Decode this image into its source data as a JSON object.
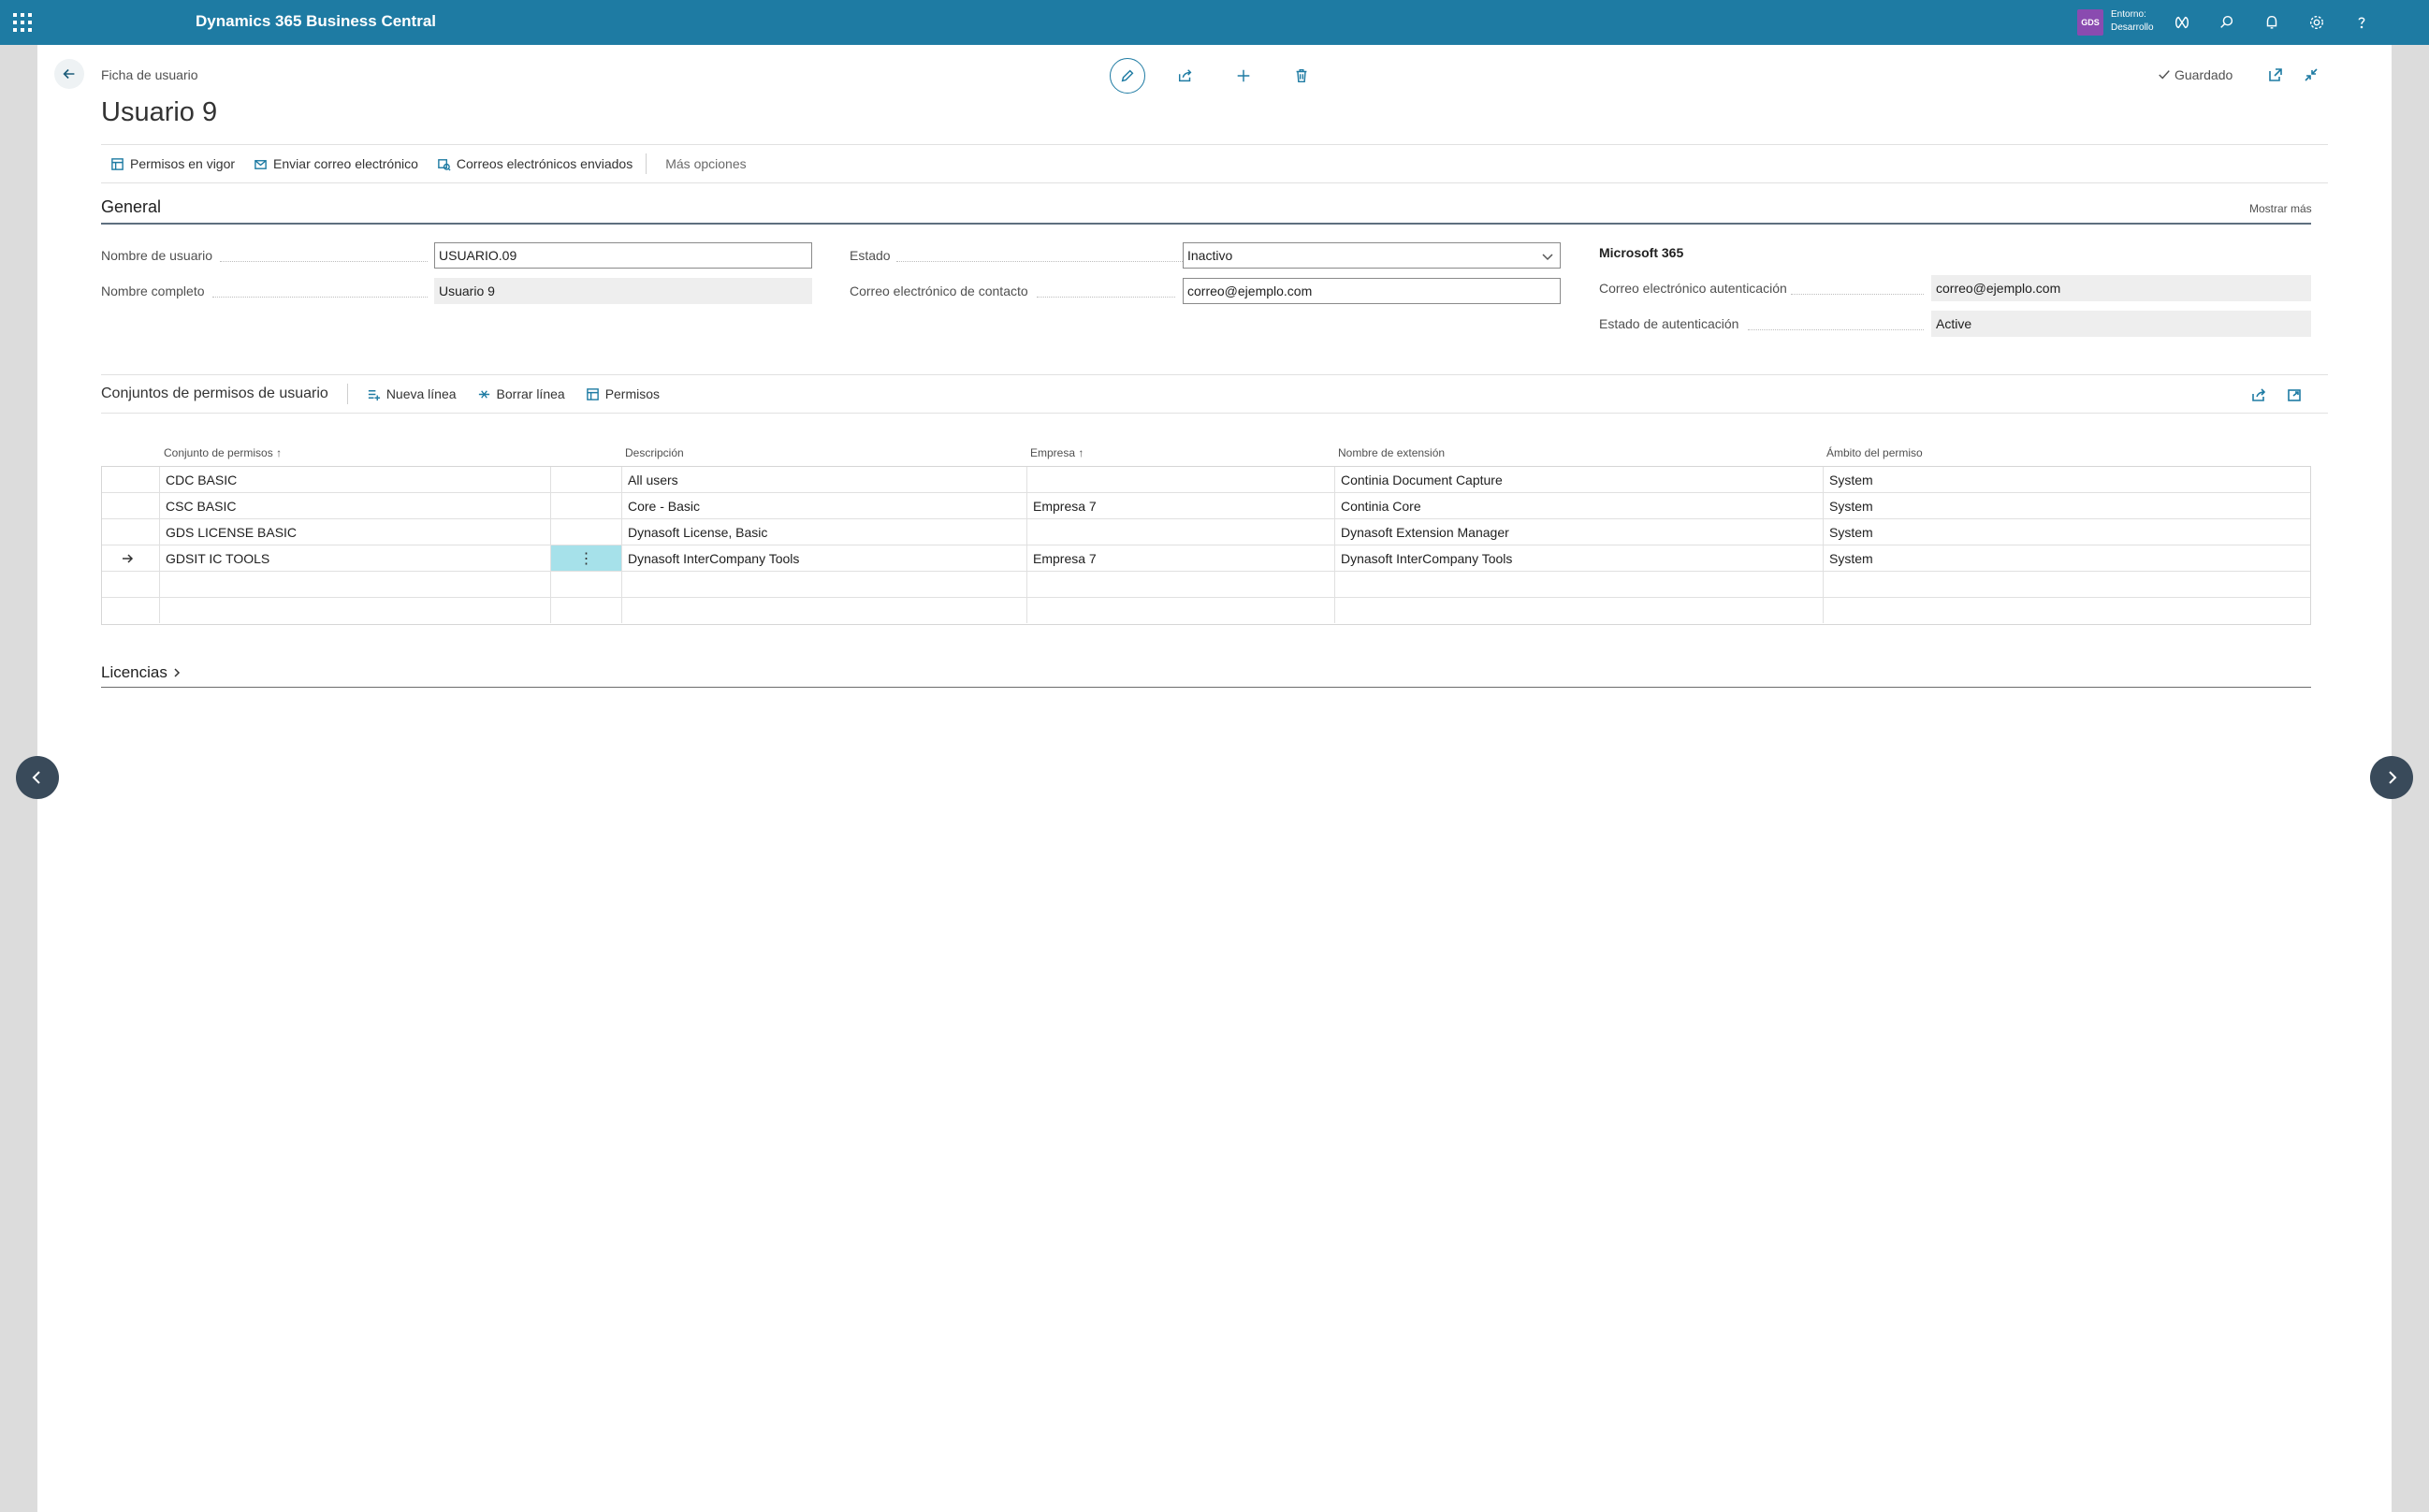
{
  "app": {
    "title": "Dynamics 365 Business Central",
    "env_badge": "GDS",
    "env_label": "Entorno:",
    "env_value": "Desarrollo"
  },
  "page": {
    "breadcrumb": "Ficha de usuario",
    "title": "Usuario 9",
    "saved_label": "Guardado"
  },
  "actions": {
    "effective_permissions": "Permisos en vigor",
    "send_email": "Enviar correo electrónico",
    "sent_emails": "Correos electrónicos enviados",
    "more_options": "Más opciones"
  },
  "general": {
    "title": "General",
    "show_more": "Mostrar más",
    "user_name_label": "Nombre de usuario",
    "user_name_value": "USUARIO.09",
    "full_name_label": "Nombre completo",
    "full_name_value": "Usuario 9",
    "state_label": "Estado",
    "state_value": "Inactivo",
    "contact_email_label": "Correo electrónico de contacto",
    "contact_email_value": "correo@ejemplo.com",
    "m365_title": "Microsoft 365",
    "auth_email_label": "Correo electrónico autenticación",
    "auth_email_value": "correo@ejemplo.com",
    "auth_state_label": "Estado de autenticación",
    "auth_state_value": "Active"
  },
  "permissions": {
    "title": "Conjuntos de permisos de usuario",
    "new_line": "Nueva línea",
    "delete_line": "Borrar línea",
    "permissions": "Permisos",
    "columns": {
      "set": "Conjunto de permisos",
      "description": "Descripción",
      "company": "Empresa",
      "extension": "Nombre de extensión",
      "scope": "Ámbito del permiso"
    },
    "rows": [
      {
        "set": "CDC BASIC",
        "description": "All users",
        "company": "",
        "extension": "Continia Document Capture",
        "scope": "System"
      },
      {
        "set": "CSC BASIC",
        "description": "Core - Basic",
        "company": "Empresa 7",
        "extension": "Continia Core",
        "scope": "System"
      },
      {
        "set": "GDS LICENSE BASIC",
        "description": "Dynasoft License, Basic",
        "company": "",
        "extension": "Dynasoft Extension Manager",
        "scope": "System"
      },
      {
        "set": "GDSIT IC TOOLS",
        "description": "Dynasoft InterCompany Tools",
        "company": "Empresa 7",
        "extension": "Dynasoft InterCompany Tools",
        "scope": "System"
      }
    ]
  },
  "licenses": {
    "title": "Licencias"
  },
  "colors": {
    "topbar": "#1e7ba3",
    "accent": "#1e7ba3",
    "selected_cell": "#a6e1ea",
    "env_badge": "#8a4bb0"
  }
}
